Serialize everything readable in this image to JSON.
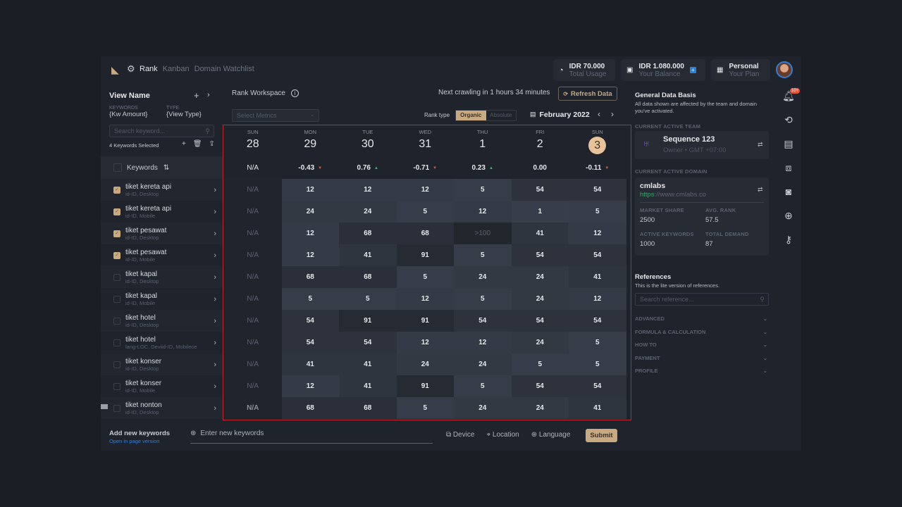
{
  "nav": {
    "tabs": [
      "Rank",
      "Kanban",
      "Domain Watchlist"
    ],
    "active": "Rank"
  },
  "chips": {
    "usage": {
      "value": "IDR 70.000",
      "label": "Total Usage"
    },
    "balance": {
      "value": "IDR 1.080.000",
      "label": "Your Balance"
    },
    "plan": {
      "value": "Personal",
      "label": "Your Plan"
    }
  },
  "left": {
    "view_name": "View Name",
    "keywords_label": "KEYWORDS",
    "keywords_value": "{Kw Amount}",
    "type_label": "TYPE",
    "type_value": "{View Type}",
    "search_placeholder": "Search keyword...",
    "selected": "4 Keywords Selected",
    "column": "Keywords",
    "keywords": [
      {
        "name": "tiket kereta api",
        "meta": "id-ID, Desktop",
        "checked": true
      },
      {
        "name": "tiket kereta api",
        "meta": "id-ID, Mobile",
        "checked": true
      },
      {
        "name": "tiket pesawat",
        "meta": "id-ID, Desktop",
        "checked": true
      },
      {
        "name": "tiket pesawat",
        "meta": "id-ID, Mobile",
        "checked": true
      },
      {
        "name": "tiket kapal",
        "meta": "id-ID, Desktop",
        "checked": false
      },
      {
        "name": "tiket kapal",
        "meta": "id-ID, Mobile",
        "checked": false
      },
      {
        "name": "tiket hotel",
        "meta": "id-ID, Desktop",
        "checked": false
      },
      {
        "name": "tiket hotel",
        "meta": "lang-LOC, Deviid-ID, Mobilece",
        "checked": false
      },
      {
        "name": "tiket konser",
        "meta": "id-ID, Desktop",
        "checked": false
      },
      {
        "name": "tiket konser",
        "meta": "id-ID, Mobile",
        "checked": false
      },
      {
        "name": "tiket nonton",
        "meta": "id-ID, Desktop",
        "checked": false
      }
    ]
  },
  "workspace": {
    "title": "Rank Workspace",
    "metrics_placeholder": "Select Metrics",
    "crawl": "Next crawling in 1 hours 34 minutes",
    "refresh": "Refresh Data",
    "rank_type_label": "Rank type",
    "rank_types": [
      "Organic",
      "Absolute"
    ],
    "rank_type_active": "Organic",
    "month": "February 2022"
  },
  "days": [
    {
      "dow": "SUN",
      "date": "28",
      "delta": "N/A",
      "trend": "none"
    },
    {
      "dow": "MON",
      "date": "29",
      "delta": "-0.43",
      "trend": "down"
    },
    {
      "dow": "TUE",
      "date": "30",
      "delta": "0.76",
      "trend": "up"
    },
    {
      "dow": "WED",
      "date": "31",
      "delta": "-0.71",
      "trend": "down"
    },
    {
      "dow": "THU",
      "date": "1",
      "delta": "0.23",
      "trend": "up"
    },
    {
      "dow": "FRI",
      "date": "2",
      "delta": "0.00",
      "trend": "none"
    },
    {
      "dow": "SUN",
      "date": "3",
      "delta": "-0.11",
      "trend": "down",
      "today": true
    }
  ],
  "ranks": [
    [
      "N/A",
      "12",
      "12",
      "12",
      "5",
      "54",
      "54"
    ],
    [
      "N/A",
      "24",
      "24",
      "5",
      "12",
      "1",
      "5"
    ],
    [
      "N/A",
      "12",
      "68",
      "68",
      ">100",
      "41",
      "12"
    ],
    [
      "N/A",
      "12",
      "41",
      "91",
      "5",
      "54",
      "54"
    ],
    [
      "N/A",
      "68",
      "68",
      "5",
      "24",
      "24",
      "41"
    ],
    [
      "N/A",
      "5",
      "5",
      "12",
      "5",
      "24",
      "12"
    ],
    [
      "N/A",
      "54",
      "91",
      "91",
      "54",
      "54",
      "54"
    ],
    [
      "N/A",
      "54",
      "54",
      "12",
      "12",
      "24",
      "5"
    ],
    [
      "N/A",
      "41",
      "41",
      "24",
      "24",
      "5",
      "5"
    ],
    [
      "N/A",
      "12",
      "41",
      "91",
      "5",
      "54",
      "54"
    ],
    [
      "N/A",
      "68",
      "68",
      "5",
      "24",
      "24",
      "41"
    ]
  ],
  "bottom": {
    "title": "Add new keywords",
    "link": "Open in page version",
    "placeholder": "Enter new keywords",
    "device": "Device",
    "location": "Location",
    "language": "Language",
    "submit": "Submit"
  },
  "right": {
    "title": "General Data Basis",
    "desc": "All data shown are affected by the team and domain you've activated.",
    "team_label": "CURRENT ACTIVE TEAM",
    "team_name": "Sequence 123",
    "team_meta": "Owner • GMT +07:00",
    "domain_label": "CURRENT ACTIVE DOMAIN",
    "domain_name": "cmlabs",
    "domain_scheme": "https",
    "domain_rest": "://www.cmlabs.co",
    "stats": [
      {
        "label": "MARKET SHARE",
        "value": "2500"
      },
      {
        "label": "AVG. RANK",
        "value": "57.5"
      },
      {
        "label": "ACTIVE KEYWORDS",
        "value": "1000"
      },
      {
        "label": "TOTAL DEMAND",
        "value": "87"
      }
    ],
    "ref_title": "References",
    "ref_desc": "This is the lite version of references.",
    "ref_placeholder": "Search reference...",
    "sections": [
      "ADVANCED",
      "FORMULA & CALCULATION",
      "HOW TO",
      "PAYMENT",
      "PROFILE"
    ]
  },
  "notification_badge": "10+",
  "colors": {
    "accent": "#c9a97f",
    "up": "#2fbf71",
    "down": "#e4573d",
    "outline": "#c0262c",
    "link": "#2f7fd6"
  }
}
